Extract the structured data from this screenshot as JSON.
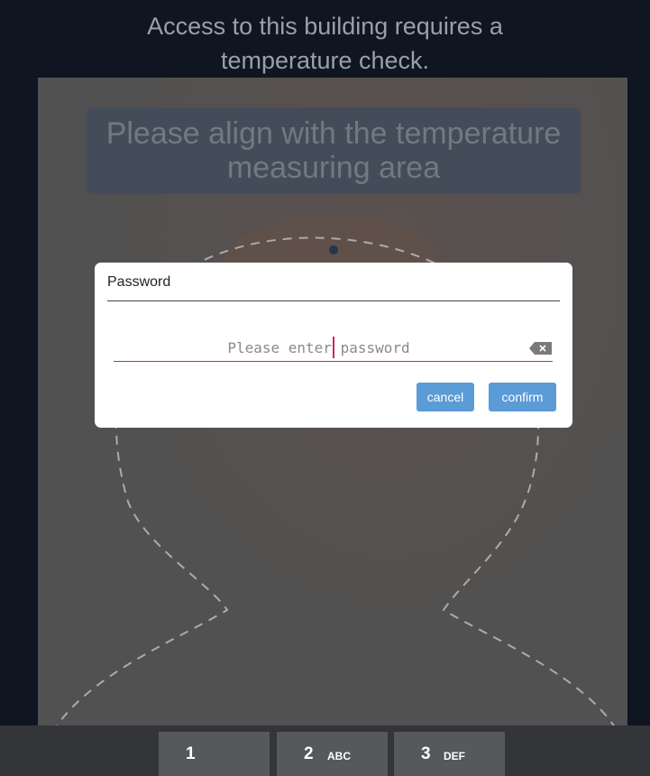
{
  "header": {
    "line1": "Access to this building requires a",
    "line2": "temperature check."
  },
  "camera": {
    "align_line1": "Please align with the temperature",
    "align_line2": "measuring area"
  },
  "dialog": {
    "title": "Password",
    "input_placeholder": "Please enter password",
    "input_value": "",
    "clear_icon": "backspace-clear-icon",
    "cancel_label": "cancel",
    "confirm_label": "confirm",
    "accent_color": "#d4245a",
    "button_color": "#5b9bd6"
  },
  "keyboard": {
    "keys": [
      {
        "num": "1",
        "letters": ""
      },
      {
        "num": "2",
        "letters": "ABC"
      },
      {
        "num": "3",
        "letters": "DEF"
      }
    ]
  }
}
